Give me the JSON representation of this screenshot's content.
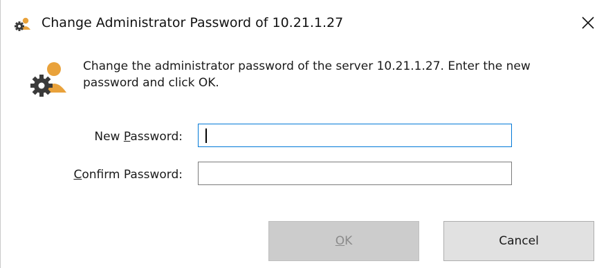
{
  "window": {
    "title": "Change Administrator Password of 10.21.1.27",
    "icon": "admin-gear-user-icon",
    "close_icon": "close-icon"
  },
  "header": {
    "icon": "admin-gear-user-icon",
    "description_line1": "Change the administrator password of the server 10.21.1.27. Enter the new",
    "description_line2": "password and click OK."
  },
  "form": {
    "new_password": {
      "label_prefix": "New ",
      "label_accel": "P",
      "label_suffix": "assword:",
      "value": ""
    },
    "confirm_password": {
      "label_prefix": "",
      "label_accel": "C",
      "label_suffix": "onfirm Password:",
      "value": ""
    }
  },
  "buttons": {
    "ok_accel": "O",
    "ok_suffix": "K",
    "ok_enabled": false,
    "cancel_label": "Cancel"
  },
  "colors": {
    "focus_border": "#0078d7",
    "disabled_button_bg": "#cccccc",
    "button_bg": "#e1e1e1",
    "gear": "#3a3a3a",
    "user_head": "#e9a23b"
  }
}
